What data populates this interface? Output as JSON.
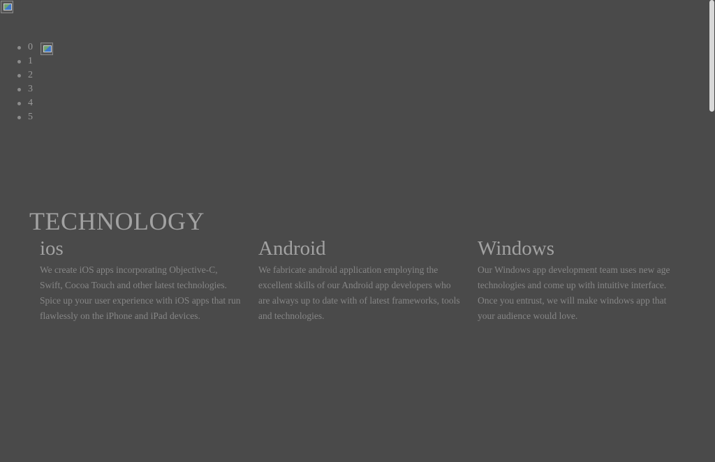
{
  "slider": {
    "items": [
      "0",
      "1",
      "2",
      "3",
      "4",
      "5"
    ]
  },
  "technology": {
    "title": "TECHNOLOGY",
    "columns": [
      {
        "heading": "ios",
        "text": "We create iOS apps incorporating Objective-C, Swift, Cocoa Touch and other latest technologies. Spice up your user experience with iOS apps that run flawlessly on the iPhone and iPad devices."
      },
      {
        "heading": "Android",
        "text": "We fabricate android application employing the excellent skills of our Android app developers who are always up to date with of latest frameworks, tools and technologies."
      },
      {
        "heading": "Windows",
        "text": "Our Windows app development team uses new age technologies and come up with intuitive interface. Once you entrust, we will make windows app that your audience would love."
      }
    ]
  },
  "colors": {
    "background": "#4a4a4a",
    "text": "#9a9a9a",
    "scroll_thumb": "#d8d8d8"
  }
}
